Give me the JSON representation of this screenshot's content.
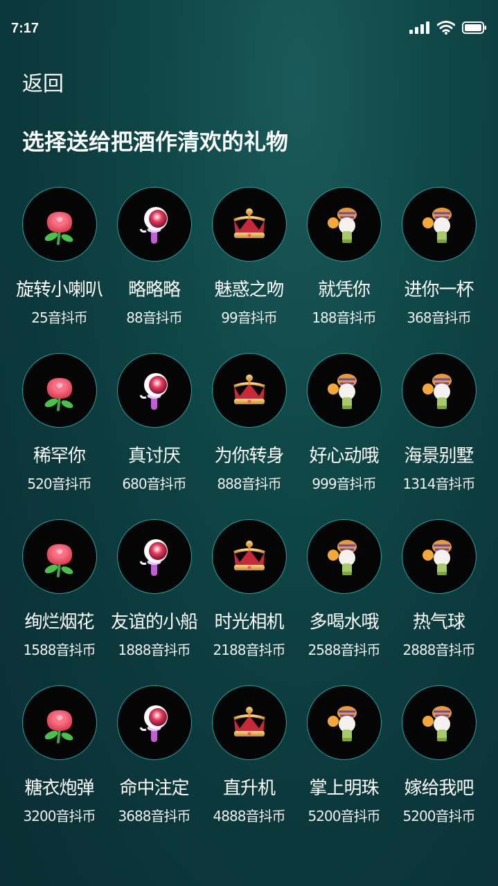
{
  "status_bar": {
    "time": "7:17"
  },
  "header": {
    "back_label": "返回",
    "title": "选择送给把酒作清欢的礼物"
  },
  "gifts": [
    {
      "name": "旋转小喇叭",
      "price": "25音抖币",
      "icon": "rose-icon"
    },
    {
      "name": "略略略",
      "price": "88音抖币",
      "icon": "magic-wand-icon"
    },
    {
      "name": "魅惑之吻",
      "price": "99音抖币",
      "icon": "crown-icon"
    },
    {
      "name": "就凭你",
      "price": "188音抖币",
      "icon": "toy-figure-icon"
    },
    {
      "name": "进你一杯",
      "price": "368音抖币",
      "icon": "toy-figure-icon"
    },
    {
      "name": "稀罕你",
      "price": "520音抖币",
      "icon": "rose-icon"
    },
    {
      "name": "真讨厌",
      "price": "680音抖币",
      "icon": "magic-wand-icon"
    },
    {
      "name": "为你转身",
      "price": "888音抖币",
      "icon": "crown-icon"
    },
    {
      "name": "好心动哦",
      "price": "999音抖币",
      "icon": "toy-figure-icon"
    },
    {
      "name": "海景别墅",
      "price": "1314音抖币",
      "icon": "toy-figure-icon"
    },
    {
      "name": "绚烂烟花",
      "price": "1588音抖币",
      "icon": "rose-icon"
    },
    {
      "name": "友谊的小船",
      "price": "1888音抖币",
      "icon": "magic-wand-icon"
    },
    {
      "name": "时光相机",
      "price": "2188音抖币",
      "icon": "crown-icon"
    },
    {
      "name": "多喝水哦",
      "price": "2588音抖币",
      "icon": "toy-figure-icon"
    },
    {
      "name": "热气球",
      "price": "2888音抖币",
      "icon": "toy-figure-icon"
    },
    {
      "name": "糖衣炮弹",
      "price": "3200音抖币",
      "icon": "rose-icon"
    },
    {
      "name": "命中注定",
      "price": "3688音抖币",
      "icon": "magic-wand-icon"
    },
    {
      "name": "直升机",
      "price": "4888音抖币",
      "icon": "crown-icon"
    },
    {
      "name": "掌上明珠",
      "price": "5200音抖币",
      "icon": "toy-figure-icon"
    },
    {
      "name": "嫁给我吧",
      "price": "5200音抖币",
      "icon": "toy-figure-icon"
    }
  ]
}
